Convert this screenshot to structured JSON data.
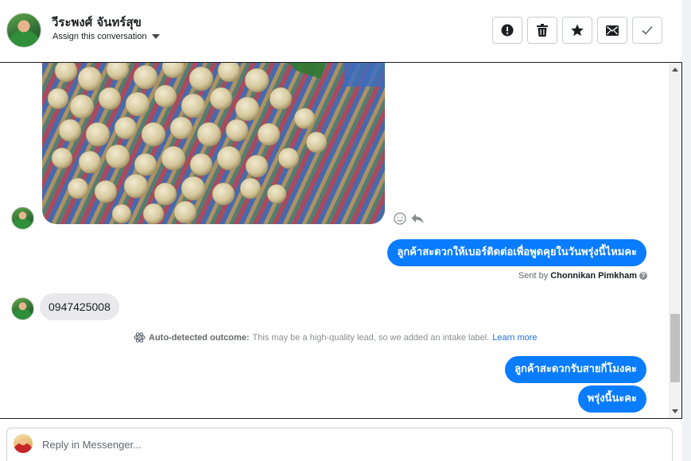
{
  "header": {
    "contact_name": "วีระพงศ์ จันทร์สุข",
    "assign_label": "Assign this conversation",
    "actions": [
      {
        "name": "mark-spam",
        "icon": "alert-circle-icon"
      },
      {
        "name": "delete",
        "icon": "trash-icon"
      },
      {
        "name": "star",
        "icon": "star-icon"
      },
      {
        "name": "mark-unread",
        "icon": "envelope-icon"
      },
      {
        "name": "mark-done",
        "icon": "checkmark-icon"
      }
    ]
  },
  "messages": [
    {
      "type": "image",
      "from": "contact",
      "alt_icon": "longan-photo"
    },
    {
      "type": "outgoing",
      "text": "ลูกค้าสะดวกให้เบอร์ติดต่อเพื่อพูดคุยในวันพรุ่งนี้ไหมคะ"
    },
    {
      "type": "incoming",
      "text": "0947425008"
    },
    {
      "type": "outgoing",
      "text": "ลูกค้าสะดวกรับสายกี่โมงคะ"
    },
    {
      "type": "outgoing",
      "text": "พรุ่งนี้นะคะ"
    }
  ],
  "sent_by": {
    "prefix": "Sent by",
    "agent": "Chonnikan Pimkham"
  },
  "auto_outcome": {
    "label": "Auto-detected outcome:",
    "text": "This may be a high-quality lead, so we added an intake label.",
    "link": "Learn more"
  },
  "reply": {
    "placeholder": "Reply in Messenger..."
  },
  "colors": {
    "accent": "#0a7cff",
    "incoming_bubble": "#e9e9eb",
    "link": "#216fdb"
  }
}
